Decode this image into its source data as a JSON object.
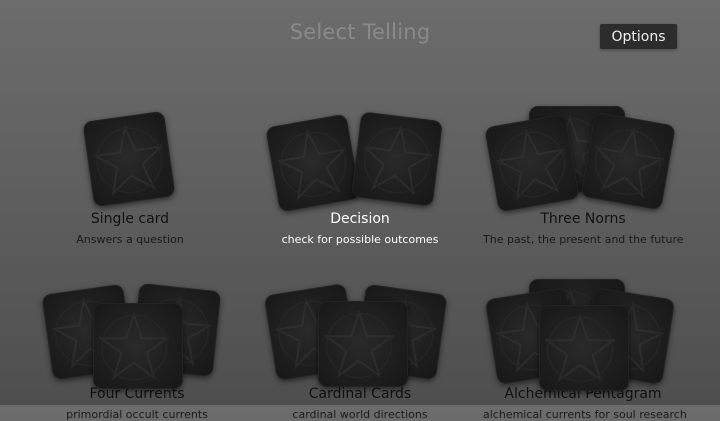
{
  "header": {
    "title": "Select Telling",
    "options_label": "Options"
  },
  "tellings": [
    {
      "title": "Single card",
      "subtitle": "Answers a question"
    },
    {
      "title": "Decision",
      "subtitle": "check for possible outcomes"
    },
    {
      "title": "Three Norns",
      "subtitle": "The past, the present and the future"
    },
    {
      "title": "Four Currents",
      "subtitle": "primordial occult currents"
    },
    {
      "title": "Cardinal Cards",
      "subtitle": "cardinal world directions"
    },
    {
      "title": "Alchemical Pentagram",
      "subtitle": "alchemical currents for soul research"
    }
  ],
  "selected_index": 1,
  "icons": {
    "card_back": "pentagram-card-back-icon"
  }
}
